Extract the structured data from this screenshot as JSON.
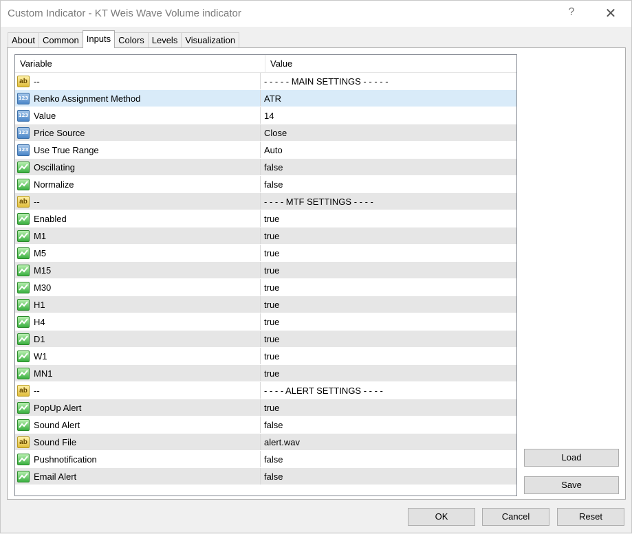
{
  "window": {
    "title": "Custom Indicator - KT Weis Wave Volume indicator",
    "help_label": "?",
    "close_label": "✕"
  },
  "tabs": [
    "About",
    "Common",
    "Inputs",
    "Colors",
    "Levels",
    "Visualization"
  ],
  "active_tab": "Inputs",
  "table": {
    "headers": {
      "variable": "Variable",
      "value": "Value"
    },
    "rows": [
      {
        "type": "string",
        "variable": "--",
        "value": "- - - - - MAIN SETTINGS - - - - -"
      },
      {
        "type": "number",
        "variable": "Renko Assignment Method",
        "value": "ATR"
      },
      {
        "type": "number",
        "variable": "Value",
        "value": "14"
      },
      {
        "type": "number",
        "variable": "Price Source",
        "value": "Close"
      },
      {
        "type": "number",
        "variable": "Use True Range",
        "value": "Auto"
      },
      {
        "type": "bool",
        "variable": "Oscillating",
        "value": "false"
      },
      {
        "type": "bool",
        "variable": "Normalize",
        "value": "false"
      },
      {
        "type": "string",
        "variable": "--",
        "value": "- - - - MTF SETTINGS - - - -"
      },
      {
        "type": "bool",
        "variable": "Enabled",
        "value": "true"
      },
      {
        "type": "bool",
        "variable": "M1",
        "value": "true"
      },
      {
        "type": "bool",
        "variable": "M5",
        "value": "true"
      },
      {
        "type": "bool",
        "variable": "M15",
        "value": "true"
      },
      {
        "type": "bool",
        "variable": "M30",
        "value": "true"
      },
      {
        "type": "bool",
        "variable": "H1",
        "value": "true"
      },
      {
        "type": "bool",
        "variable": "H4",
        "value": "true"
      },
      {
        "type": "bool",
        "variable": "D1",
        "value": "true"
      },
      {
        "type": "bool",
        "variable": "W1",
        "value": "true"
      },
      {
        "type": "bool",
        "variable": "MN1",
        "value": "true"
      },
      {
        "type": "string",
        "variable": "--",
        "value": "- - - - ALERT SETTINGS - - - -"
      },
      {
        "type": "bool",
        "variable": "PopUp Alert",
        "value": "true"
      },
      {
        "type": "bool",
        "variable": "Sound Alert",
        "value": "false"
      },
      {
        "type": "string",
        "variable": "Sound File",
        "value": "alert.wav"
      },
      {
        "type": "bool",
        "variable": "Pushnotification",
        "value": "false"
      },
      {
        "type": "bool",
        "variable": "Email Alert",
        "value": "false"
      }
    ]
  },
  "icons": {
    "number": "123",
    "string": "ab"
  },
  "buttons": {
    "load": "Load",
    "save": "Save",
    "ok": "OK",
    "cancel": "Cancel",
    "reset": "Reset"
  }
}
